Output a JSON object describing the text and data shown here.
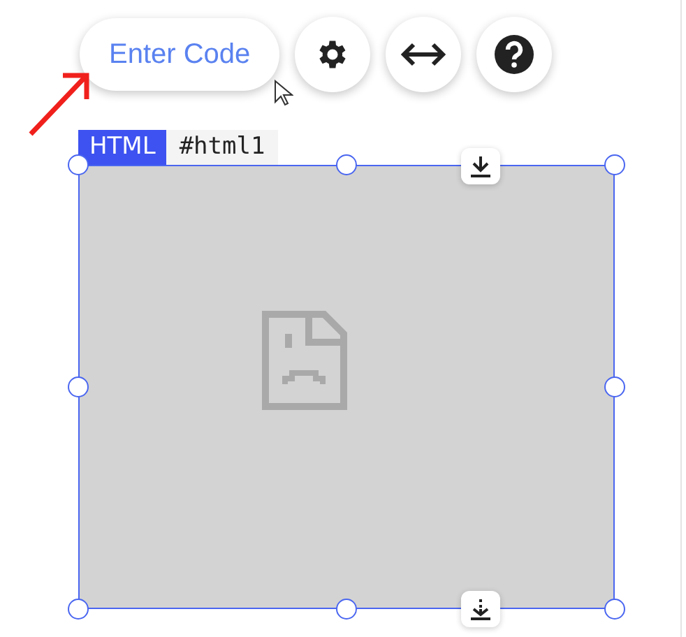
{
  "toolbar": {
    "enter_code_button": "Enter Code"
  },
  "element": {
    "type_label": "HTML",
    "id_label": "#html1",
    "selected": true
  }
}
